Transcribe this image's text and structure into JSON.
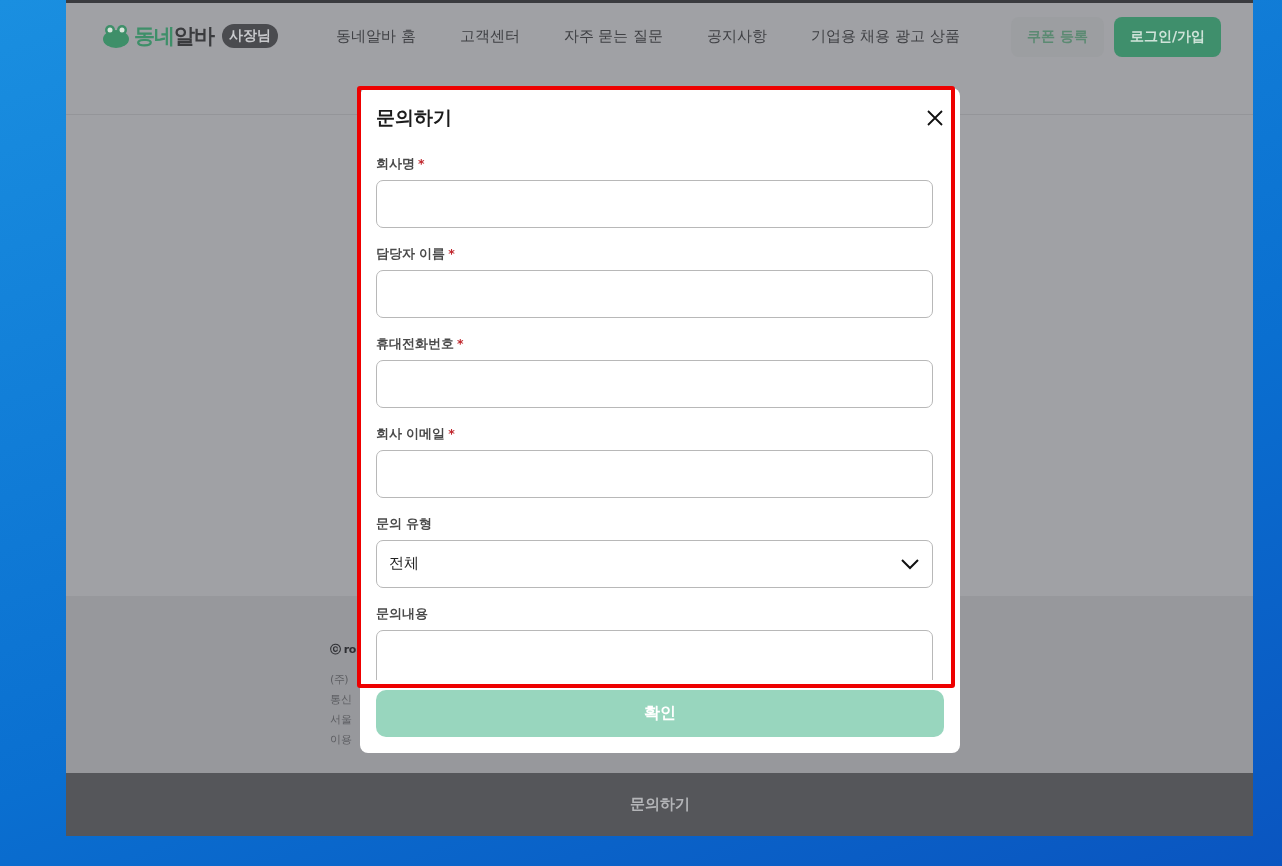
{
  "header": {
    "logo_accent": "동네",
    "logo_rest": "알바",
    "badge": "사장님",
    "nav": [
      "동네알바 홈",
      "고객센터",
      "자주 묻는 질문",
      "공지사항",
      "기업용 채용 광고 상품"
    ],
    "buttons": [
      {
        "label": "쿠폰 등록",
        "kind": "secondary"
      },
      {
        "label": "로그인/가입",
        "kind": "primary"
      }
    ]
  },
  "footer_fragments": [
    "ⓒ ro",
    "(주)",
    "통신",
    "서울",
    "이용"
  ],
  "modal": {
    "title": "문의하기",
    "fields": [
      {
        "label": "회사명",
        "required_mark": "*",
        "kind": "text"
      },
      {
        "label": "담당자 이름",
        "required_mark": "*",
        "kind": "text"
      },
      {
        "label": "휴대전화번호",
        "required_mark": "*",
        "kind": "text"
      },
      {
        "label": "회사 이메일",
        "required_mark": "*",
        "kind": "text"
      },
      {
        "label": "문의 유형",
        "kind": "select",
        "value": "전체"
      },
      {
        "label": "문의내용",
        "kind": "textarea"
      }
    ],
    "submit": {
      "label": "확인",
      "disabled": true
    }
  },
  "bottom_bar": {
    "label": "문의하기"
  }
}
